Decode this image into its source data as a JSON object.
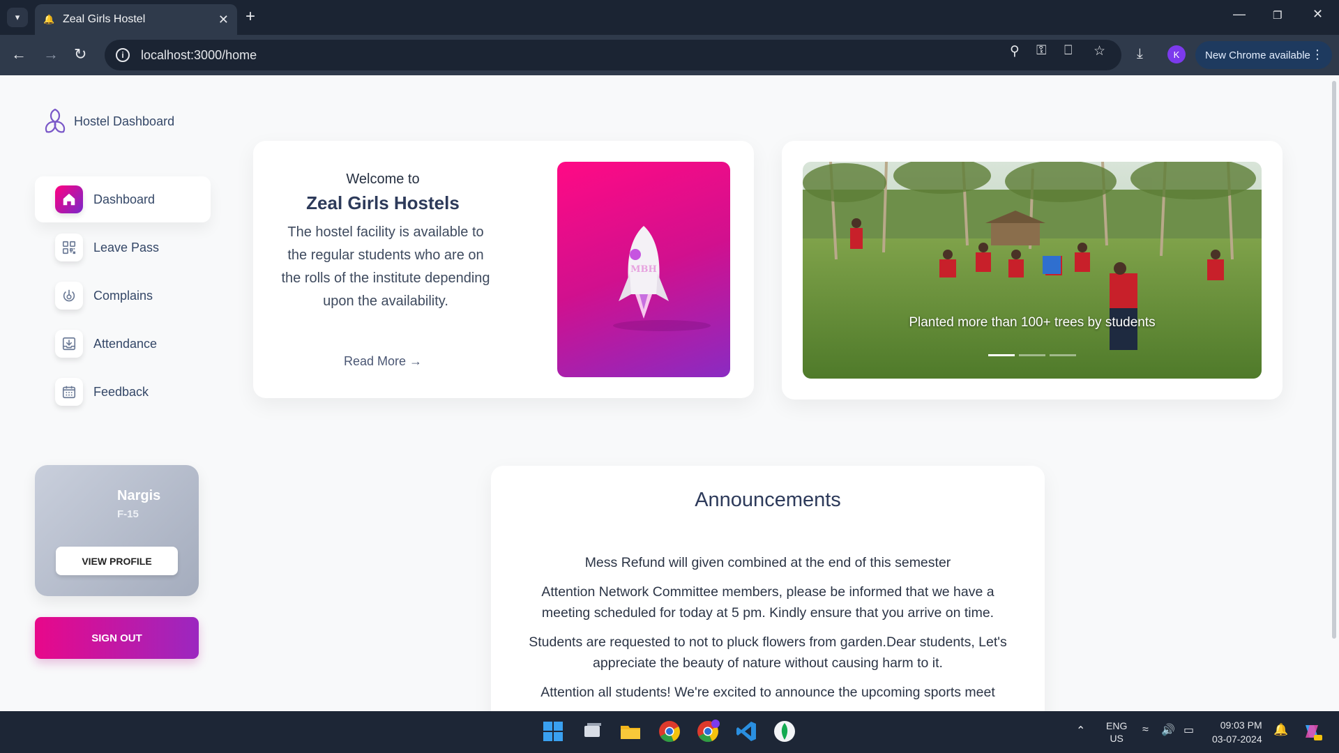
{
  "browser": {
    "tab_title": "Zeal Girls Hostel",
    "url": "localhost:3000/home",
    "profile_initial": "K",
    "update_label": "New Chrome available"
  },
  "sidebar": {
    "brand": "Hostel Dashboard",
    "items": [
      {
        "label": "Dashboard",
        "icon": "home-icon",
        "active": true
      },
      {
        "label": "Leave Pass",
        "icon": "qr-code-icon"
      },
      {
        "label": "Complains",
        "icon": "power-icon"
      },
      {
        "label": "Attendance",
        "icon": "inbox-download-icon"
      },
      {
        "label": "Feedback",
        "icon": "calendar-icon"
      }
    ]
  },
  "profile": {
    "name": "Nargis",
    "room": "F-15",
    "view_button": "VIEW PROFILE"
  },
  "signout_label": "SIGN OUT",
  "welcome": {
    "pre": "Welcome to",
    "title": "Zeal Girls Hostels",
    "description": "The hostel facility is available to the regular students who are on the rolls of the institute depending upon the availability.",
    "read_more": "Read More",
    "rocket_text": "MBH"
  },
  "carousel": {
    "caption": "Planted more than 100+ trees by students",
    "slides": 3,
    "active_slide": 1
  },
  "announcements": {
    "title": "Announcements",
    "items": [
      "Mess Refund will given combined at the end of this semester",
      "Attention Network Committee members, please be informed that we have a meeting scheduled for today at 5 pm. Kindly ensure that you arrive on time.",
      "Students are requested to not to pluck flowers from garden.Dear students, Let's appreciate the beauty of nature without causing harm to it.",
      "Attention all students! We're excited to announce the upcoming sports meet"
    ]
  },
  "taskbar": {
    "lang_top": "ENG",
    "lang_bottom": "US",
    "time": "09:03 PM",
    "date": "03-07-2024"
  },
  "colors": {
    "accent_gradient_start": "#ff0080",
    "accent_gradient_end": "#7928ca",
    "text_dark": "#344767"
  }
}
